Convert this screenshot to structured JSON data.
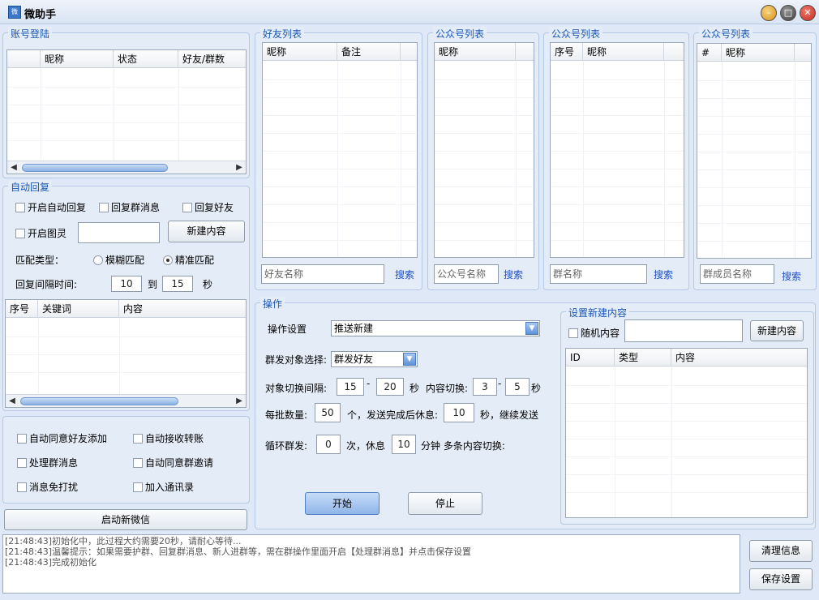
{
  "window": {
    "title": "微助手",
    "icon_text": "微",
    "controls": {
      "minimize": "–",
      "restore": "□",
      "close": "✕"
    }
  },
  "account": {
    "legend": "账号登陆",
    "columns": [
      "",
      "昵称",
      "状态",
      "好友/群数"
    ]
  },
  "auto_reply": {
    "legend": "自动回复",
    "enable_auto_reply": "开启自动回复",
    "reply_group_msg": "回复群消息",
    "reply_friend": "回复好友",
    "enable_tuling": "开启图灵",
    "new_content_button": "新建内容",
    "match_type_label": "匹配类型：",
    "fuzzy_match": "模糊匹配",
    "exact_match": "精准匹配",
    "interval_label": "回复间隔时间:",
    "interval_from": "10",
    "to_label": "到",
    "interval_to": "15",
    "unit_seconds": "秒",
    "keyword_columns": [
      "序号",
      "关键词",
      "内容"
    ]
  },
  "options": {
    "auto_accept_friend": "自动同意好友添加",
    "auto_receive_transfer": "自动接收转账",
    "handle_group_msg": "处理群消息",
    "auto_accept_group_invite": "自动同意群邀请",
    "mute_messages": "消息免打扰",
    "add_to_contacts": "加入通讯录"
  },
  "launch_button": "启动新微信",
  "friends": {
    "legend": "好友列表",
    "columns": [
      "昵称",
      "备注"
    ],
    "search_placeholder": "好友名称",
    "search_link": "搜索"
  },
  "official1": {
    "legend": "公众号列表",
    "columns": [
      "昵称"
    ],
    "search_placeholder": "公众号名称",
    "search_link": "搜索"
  },
  "official2": {
    "legend": "公众号列表",
    "columns": [
      "序号",
      "昵称"
    ],
    "search_placeholder": "群名称",
    "search_link": "搜索"
  },
  "official3": {
    "legend": "公众号列表",
    "columns": [
      "#",
      "昵称"
    ],
    "search_placeholder": "群成员名称",
    "search_link": "搜索"
  },
  "operation": {
    "legend": "操作",
    "settings_label": "操作设置",
    "settings_value": "推送新建",
    "target_label": "群发对象选择:",
    "target_value": "群发好友",
    "switch_interval_label": "对象切换间隔:",
    "switch_from": "15",
    "dash": "-",
    "switch_to": "20",
    "seconds": "秒",
    "content_switch_label": "内容切换:",
    "content_from": "3",
    "content_to": "5",
    "batch_label": "每批数量:",
    "batch_value": "50",
    "batch_unit": "个，发送完成后休息:",
    "rest_value": "10",
    "rest_unit": "秒，继续发送",
    "loop_label": "循环群发:",
    "loop_value": "0",
    "loop_unit": "次，休息",
    "loop_rest_value": "10",
    "loop_rest_unit": "分钟 多条内容切换:",
    "start_button": "开始",
    "stop_button": "停止"
  },
  "new_content": {
    "legend": "设置新建内容",
    "random_label": "随机内容",
    "new_button": "新建内容",
    "columns": [
      "ID",
      "类型",
      "内容"
    ]
  },
  "log": {
    "lines": [
      "[21:48:43]初始化中，此过程大约需要20秒，请耐心等待...",
      "[21:48:43]温馨提示：如果需要护群、回复群消息、新人进群等，需在群操作里面开启【处理群消息】并点击保存设置",
      "[21:48:43]完成初始化"
    ]
  },
  "clear_button": "清理信息",
  "save_button": "保存设置"
}
